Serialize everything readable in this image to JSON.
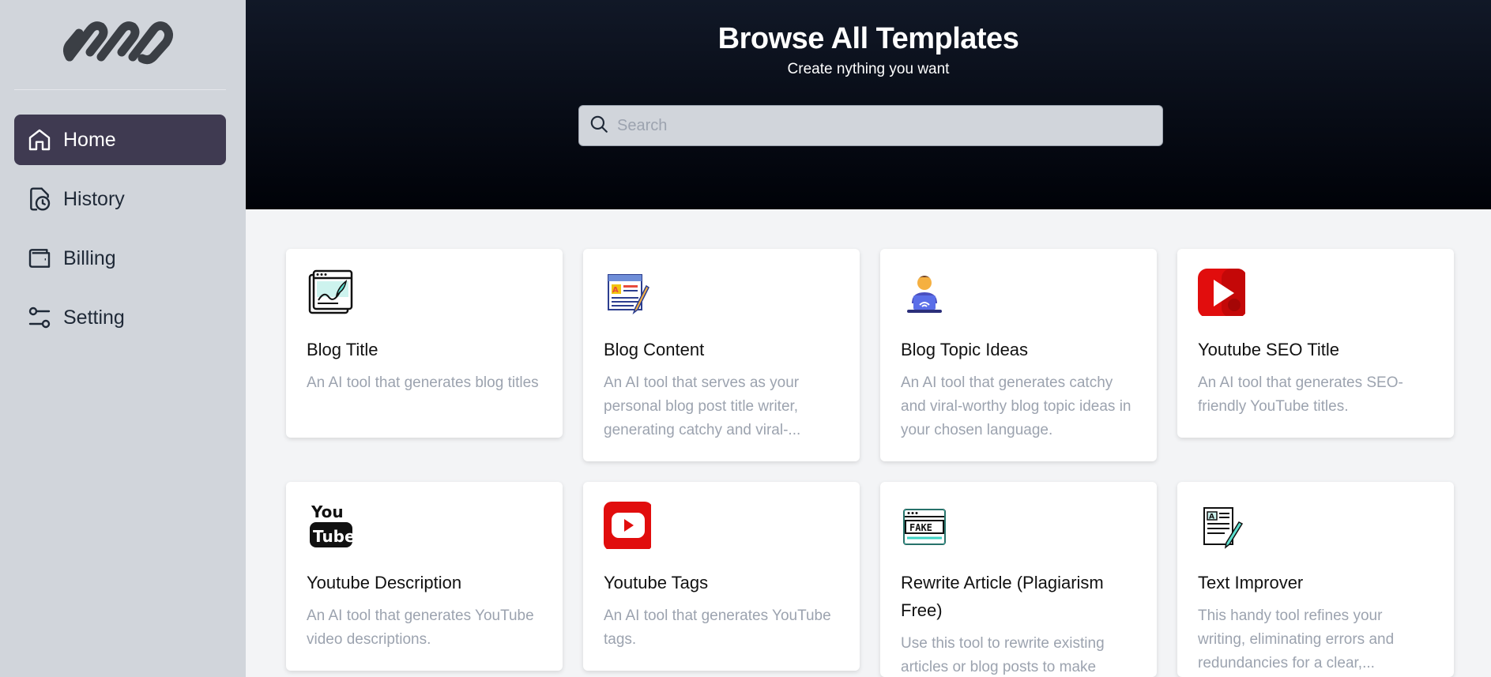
{
  "sidebar": {
    "items": [
      {
        "label": "Home",
        "icon": "home-icon",
        "active": true
      },
      {
        "label": "History",
        "icon": "history-icon",
        "active": false
      },
      {
        "label": "Billing",
        "icon": "wallet-icon",
        "active": false
      },
      {
        "label": "Setting",
        "icon": "sliders-icon",
        "active": false
      }
    ]
  },
  "header": {
    "title": "Browse All Templates",
    "subtitle": "Create nything you want",
    "search_placeholder": "Search"
  },
  "cards": [
    {
      "title": "Blog Title",
      "desc": "An AI tool that generates blog titles",
      "icon": "blog-title-icon"
    },
    {
      "title": "Blog Content",
      "desc": "An AI tool that serves as your personal blog post title writer, generating catchy and viral-...",
      "icon": "blog-content-icon"
    },
    {
      "title": "Blog Topic Ideas",
      "desc": "An AI tool that generates catchy and viral-worthy blog topic ideas in your chosen language.",
      "icon": "blog-topic-icon"
    },
    {
      "title": "Youtube SEO Title",
      "desc": "An AI tool that generates SEO-friendly YouTube titles.",
      "icon": "youtube-play-icon"
    },
    {
      "title": "Youtube Description",
      "desc": "An AI tool that generates YouTube video descriptions.",
      "icon": "youtube-logo-icon"
    },
    {
      "title": "Youtube Tags",
      "desc": "An AI tool that generates YouTube tags.",
      "icon": "youtube-tags-icon"
    },
    {
      "title": "Rewrite Article (Plagiarism Free)",
      "desc": "Use this tool to rewrite existing articles or blog posts to make",
      "icon": "fake-browser-icon"
    },
    {
      "title": "Text Improver",
      "desc": "This handy tool refines your writing, eliminating errors and redundancies for a clear,...",
      "icon": "text-improver-icon"
    }
  ],
  "icon_text": {
    "youtube_you": "You",
    "youtube_tube": "Tube",
    "fake": "FAKE"
  },
  "colors": {
    "sidebar_bg": "#d1d5db",
    "active_nav": "#3f3a51",
    "header_bg": "#0b0f1a",
    "youtube_red": "#e10d0d"
  }
}
